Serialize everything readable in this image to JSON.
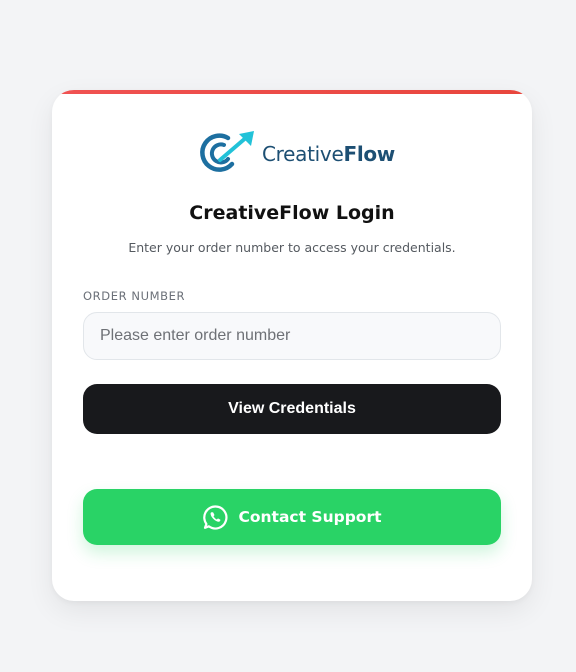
{
  "brand": {
    "name_light": "Creative",
    "name_bold": "Flow",
    "logo_icon": "creativeflow-logo-icon",
    "colors": {
      "text": "#1d4f73",
      "ring": "#1d6fa0",
      "arrow": "#22c2d8"
    }
  },
  "login": {
    "title": "CreativeFlow Login",
    "subtitle": "Enter your order number to access your credentials."
  },
  "order_field": {
    "label": "ORDER NUMBER",
    "value": "",
    "placeholder": "Please enter order number"
  },
  "actions": {
    "view_label": "View Credentials",
    "support_label": "Contact Support",
    "support_icon": "whatsapp-icon"
  },
  "colors": {
    "accent_bar": "#e8453c",
    "primary_button": "#18191c",
    "support_button": "#29d366",
    "background": "#f3f4f6"
  }
}
